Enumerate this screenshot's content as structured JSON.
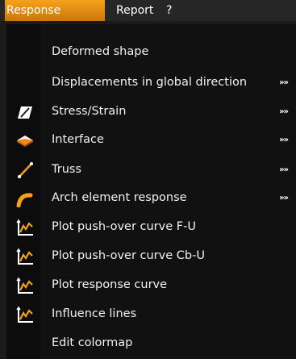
{
  "menubar": {
    "items": [
      "Response",
      "Report",
      "?"
    ]
  },
  "menu": {
    "items": [
      {
        "label": "Deformed shape",
        "icon": "none",
        "submenu": false
      },
      {
        "label": "Displacements in global direction",
        "icon": "none",
        "submenu": true
      },
      {
        "label": "Stress/Strain",
        "icon": "stress-strain-icon",
        "submenu": true
      },
      {
        "label": "Interface",
        "icon": "interface-icon",
        "submenu": true
      },
      {
        "label": "Truss",
        "icon": "truss-icon",
        "submenu": true
      },
      {
        "label": "Arch element response",
        "icon": "arch-icon",
        "submenu": true
      },
      {
        "label": "Plot push-over curve F-U",
        "icon": "plot-curve-icon",
        "submenu": false
      },
      {
        "label": "Plot push-over curve Cb-U",
        "icon": "plot-curve-icon",
        "submenu": false
      },
      {
        "label": "Plot response curve",
        "icon": "plot-curve-icon",
        "submenu": false
      },
      {
        "label": "Influence lines",
        "icon": "plot-curve-icon",
        "submenu": false
      },
      {
        "label": "Edit colormap",
        "icon": "none",
        "submenu": false
      }
    ],
    "submenu_glyph": "»»"
  },
  "colors": {
    "accent": "#f0a020",
    "background": "#111111",
    "text": "#f2f2f2"
  }
}
